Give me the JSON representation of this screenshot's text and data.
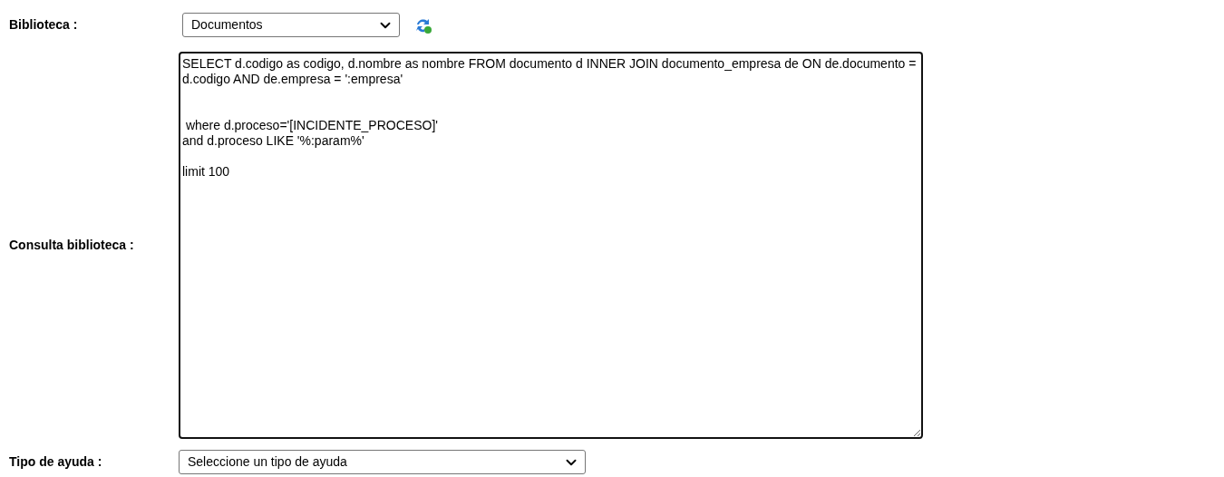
{
  "biblioteca": {
    "label": "Biblioteca :",
    "value": "Documentos"
  },
  "consulta": {
    "label": "Consulta biblioteca :",
    "value": "SELECT d.codigo as codigo, d.nombre as nombre FROM documento d INNER JOIN documento_empresa de ON de.documento = d.codigo AND de.empresa = ':empresa'\n\n\n where d.proceso='[INCIDENTE_PROCESO]'\nand d.proceso LIKE '%:param%'\n\nlimit 100"
  },
  "tipo_ayuda": {
    "label": "Tipo de ayuda :",
    "value": "Seleccione un tipo de ayuda"
  }
}
